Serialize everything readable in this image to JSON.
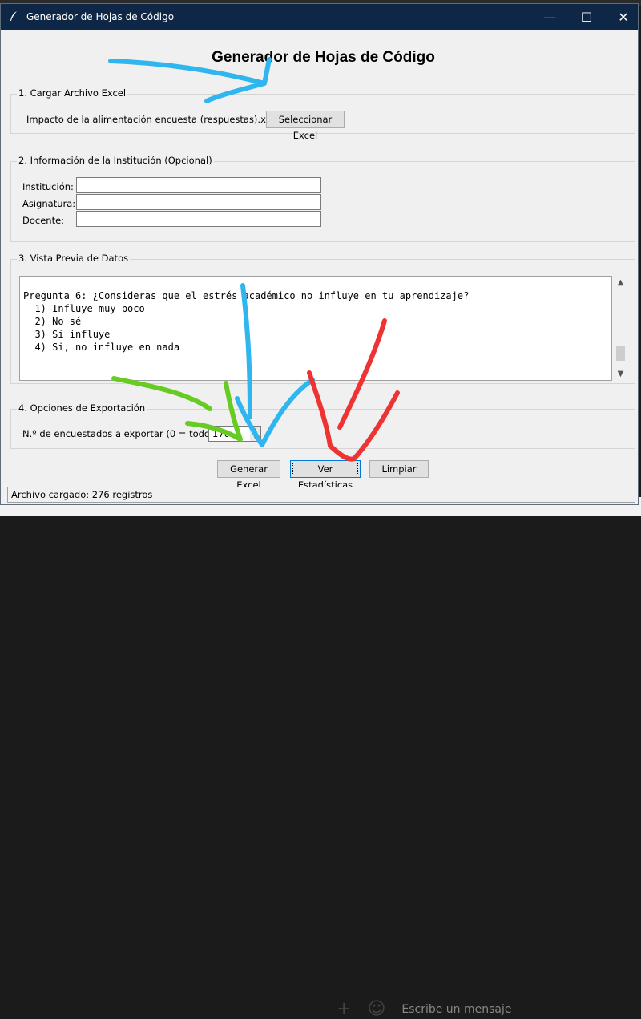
{
  "window": {
    "title": "Generador de Hojas de Código"
  },
  "app": {
    "heading": "Generador de Hojas de Código"
  },
  "section1": {
    "title": "1. Cargar Archivo Excel",
    "filename": "Impacto de la alimentación encuesta  (respuestas).xlsx",
    "button": "Seleccionar Excel"
  },
  "section2": {
    "title": "2. Información de la Institución (Opcional)",
    "institucion_label": "Institución:",
    "asignatura_label": "Asignatura:",
    "docente_label": "Docente:",
    "institucion_value": "",
    "asignatura_value": "",
    "docente_value": ""
  },
  "section3": {
    "title": "3. Vista Previa de Datos",
    "preview": "\nPregunta 6: ¿Consideras que el estrés académico no influye en tu aprendizaje?\n  1) Influye muy poco\n  2) No sé\n  3) Si influye\n  4) Si, no influye en nada",
    "scroll_fraction": 0.9
  },
  "section4": {
    "title": "4. Opciones de Exportación",
    "count_label": "N.º de encuestados a exportar (0 = todos):",
    "count_value": "170"
  },
  "buttons": {
    "generate": "Generar Excel",
    "stats": "Ver Estadísticas",
    "clear": "Limpiar"
  },
  "status": {
    "text": "Archivo cargado: 276 registros"
  },
  "background": {
    "chat_placeholder": "Escribe un mensaje"
  },
  "annotations": {
    "blue": "#2fb6ee",
    "green": "#66cc22",
    "red": "#ee3333"
  },
  "icons": {
    "app": "feather-icon",
    "minimize": "minimize-icon",
    "maximize": "maximize-icon",
    "close": "close-icon",
    "scroll_up": "chevron-up-icon",
    "scroll_down": "chevron-down-icon",
    "spin_up": "spin-up-icon",
    "spin_down": "spin-down-icon",
    "plus": "plus-icon",
    "emoji": "emoji-icon"
  }
}
